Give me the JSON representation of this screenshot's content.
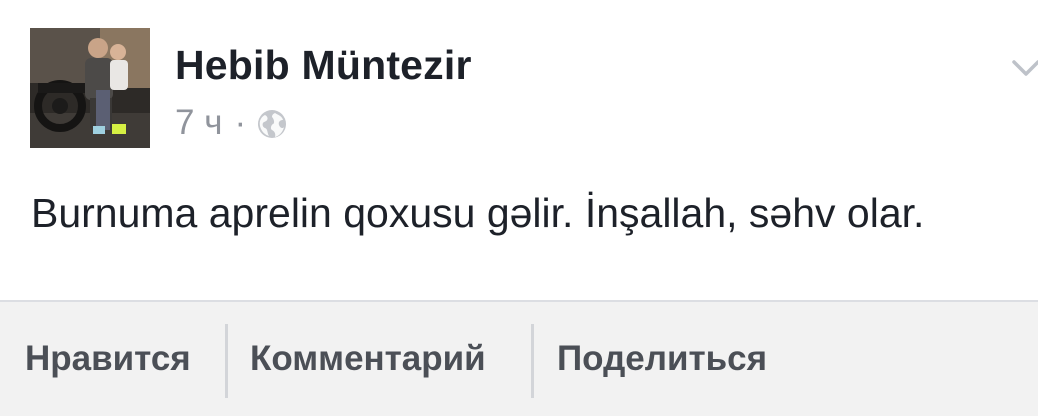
{
  "post": {
    "author": {
      "name": "Hebib Müntezir"
    },
    "meta": {
      "time": "7 ч",
      "separator": "·",
      "privacy_icon": "globe-icon"
    },
    "text": "Burnuma aprelin qoxusu gəlir. İnşallah, səhv olar.",
    "menu_icon": "chevron-down-icon"
  },
  "actions": {
    "like_label": "Нравится",
    "comment_label": "Комментарий",
    "share_label": "Поделиться"
  },
  "colors": {
    "text_primary": "#1d2129",
    "text_secondary": "#90949c",
    "action_text": "#4b4f56",
    "action_bar_bg": "#f2f2f2"
  }
}
